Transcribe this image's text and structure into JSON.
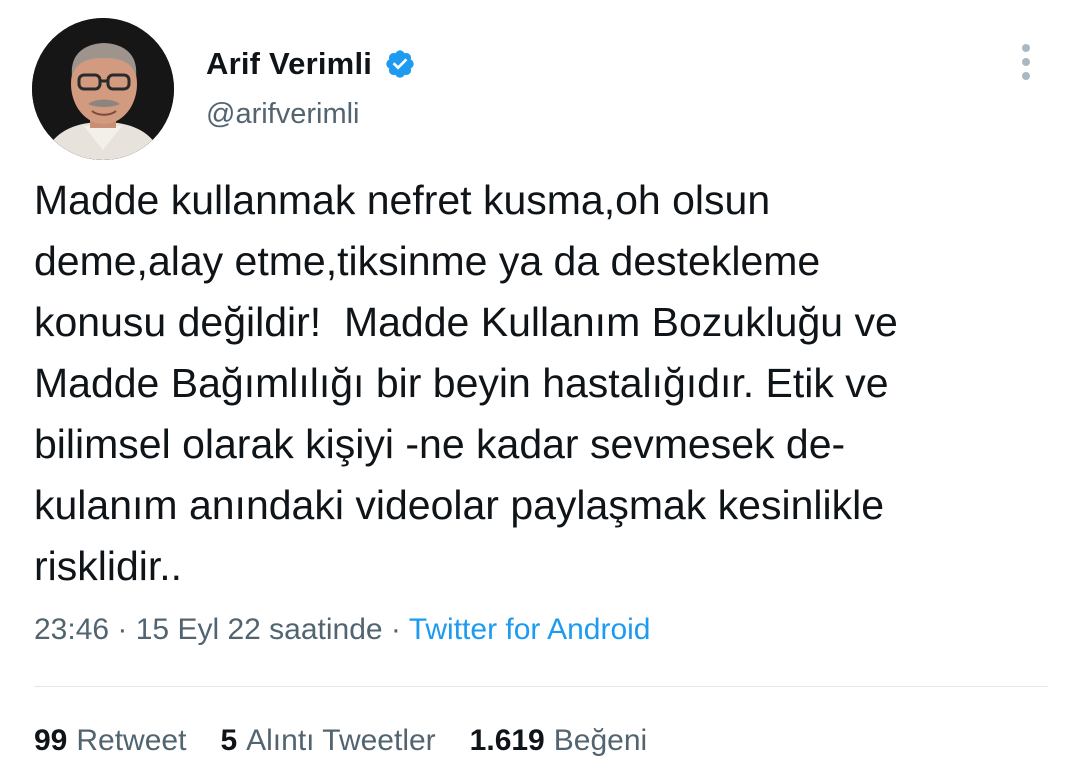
{
  "author": {
    "display_name": "Arif Verimli",
    "handle": "@arifverimli",
    "verified_icon": "verified-badge-icon",
    "avatar_icon": "profile-photo"
  },
  "menu_icon": "more-vertical-icon",
  "tweet": {
    "lines": [
      "Madde kullanmak nefret kusma,oh olsun",
      "deme,alay etme,tiksinme ya da destekleme",
      "konusu değildir!  Madde Kullanım Bozukluğu ve",
      "Madde Bağımlılığı bir beyin hastalığıdır. Etik ve",
      "bilimsel olarak kişiyi -ne kadar sevmesek de-",
      "kulanım anındaki videolar paylaşmak kesinlikle",
      "risklidir.."
    ]
  },
  "meta": {
    "time": "23:46",
    "date": "15 Eyl 22 saatinde",
    "separator": " · ",
    "source": "Twitter for Android"
  },
  "stats": {
    "retweets": {
      "count": "99",
      "label": "Retweet"
    },
    "quotes": {
      "count": "5",
      "label": "Alıntı Tweetler"
    },
    "likes": {
      "count": "1.619",
      "label": "Beğeni"
    }
  },
  "colors": {
    "text": "#0f1419",
    "secondary": "#536471",
    "accent": "#1d9bf0",
    "divider": "#e1e8ed"
  }
}
